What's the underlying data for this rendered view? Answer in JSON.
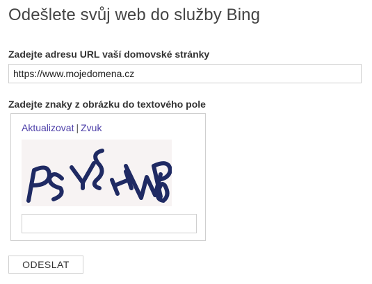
{
  "page": {
    "title": "Odešlete svůj web do služby Bing"
  },
  "url_section": {
    "label": "Zadejte adresu URL vaší domovské stránky",
    "value": "https://www.mojedomena.cz"
  },
  "captcha_section": {
    "label": "Zadejte znaky z obrázku do textového pole",
    "refresh_label": "Aktualizovat",
    "separator": "|",
    "audio_label": "Zvuk",
    "captcha_text": "PSYSHWP",
    "input_value": ""
  },
  "submit": {
    "label": "ODESLAT"
  },
  "colors": {
    "link": "#4c3ea8",
    "captcha_ink": "#1f2a63",
    "captcha_bg": "#f7f3f3"
  }
}
